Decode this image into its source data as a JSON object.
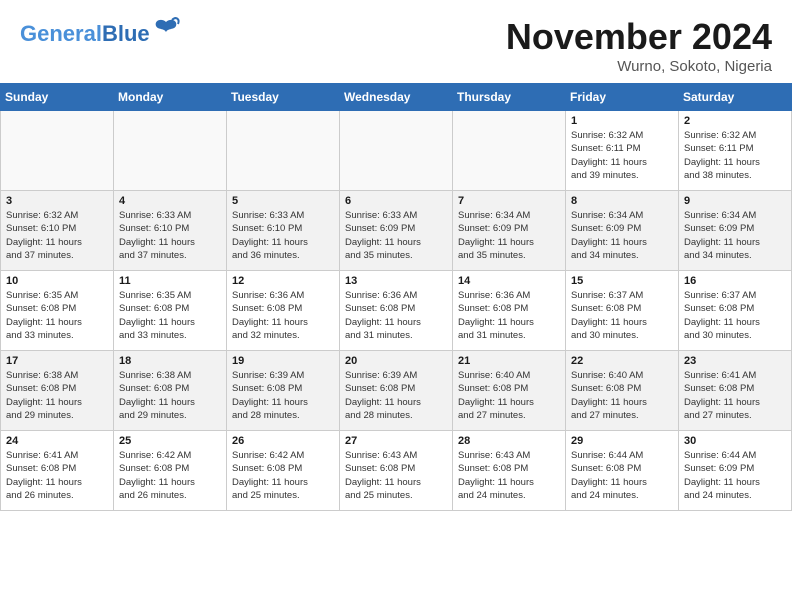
{
  "header": {
    "logo_general": "General",
    "logo_blue": "Blue",
    "title": "November 2024",
    "location": "Wurno, Sokoto, Nigeria"
  },
  "weekdays": [
    "Sunday",
    "Monday",
    "Tuesday",
    "Wednesday",
    "Thursday",
    "Friday",
    "Saturday"
  ],
  "weeks": [
    [
      {
        "day": "",
        "info": ""
      },
      {
        "day": "",
        "info": ""
      },
      {
        "day": "",
        "info": ""
      },
      {
        "day": "",
        "info": ""
      },
      {
        "day": "",
        "info": ""
      },
      {
        "day": "1",
        "info": "Sunrise: 6:32 AM\nSunset: 6:11 PM\nDaylight: 11 hours\nand 39 minutes."
      },
      {
        "day": "2",
        "info": "Sunrise: 6:32 AM\nSunset: 6:11 PM\nDaylight: 11 hours\nand 38 minutes."
      }
    ],
    [
      {
        "day": "3",
        "info": "Sunrise: 6:32 AM\nSunset: 6:10 PM\nDaylight: 11 hours\nand 37 minutes."
      },
      {
        "day": "4",
        "info": "Sunrise: 6:33 AM\nSunset: 6:10 PM\nDaylight: 11 hours\nand 37 minutes."
      },
      {
        "day": "5",
        "info": "Sunrise: 6:33 AM\nSunset: 6:10 PM\nDaylight: 11 hours\nand 36 minutes."
      },
      {
        "day": "6",
        "info": "Sunrise: 6:33 AM\nSunset: 6:09 PM\nDaylight: 11 hours\nand 35 minutes."
      },
      {
        "day": "7",
        "info": "Sunrise: 6:34 AM\nSunset: 6:09 PM\nDaylight: 11 hours\nand 35 minutes."
      },
      {
        "day": "8",
        "info": "Sunrise: 6:34 AM\nSunset: 6:09 PM\nDaylight: 11 hours\nand 34 minutes."
      },
      {
        "day": "9",
        "info": "Sunrise: 6:34 AM\nSunset: 6:09 PM\nDaylight: 11 hours\nand 34 minutes."
      }
    ],
    [
      {
        "day": "10",
        "info": "Sunrise: 6:35 AM\nSunset: 6:08 PM\nDaylight: 11 hours\nand 33 minutes."
      },
      {
        "day": "11",
        "info": "Sunrise: 6:35 AM\nSunset: 6:08 PM\nDaylight: 11 hours\nand 33 minutes."
      },
      {
        "day": "12",
        "info": "Sunrise: 6:36 AM\nSunset: 6:08 PM\nDaylight: 11 hours\nand 32 minutes."
      },
      {
        "day": "13",
        "info": "Sunrise: 6:36 AM\nSunset: 6:08 PM\nDaylight: 11 hours\nand 31 minutes."
      },
      {
        "day": "14",
        "info": "Sunrise: 6:36 AM\nSunset: 6:08 PM\nDaylight: 11 hours\nand 31 minutes."
      },
      {
        "day": "15",
        "info": "Sunrise: 6:37 AM\nSunset: 6:08 PM\nDaylight: 11 hours\nand 30 minutes."
      },
      {
        "day": "16",
        "info": "Sunrise: 6:37 AM\nSunset: 6:08 PM\nDaylight: 11 hours\nand 30 minutes."
      }
    ],
    [
      {
        "day": "17",
        "info": "Sunrise: 6:38 AM\nSunset: 6:08 PM\nDaylight: 11 hours\nand 29 minutes."
      },
      {
        "day": "18",
        "info": "Sunrise: 6:38 AM\nSunset: 6:08 PM\nDaylight: 11 hours\nand 29 minutes."
      },
      {
        "day": "19",
        "info": "Sunrise: 6:39 AM\nSunset: 6:08 PM\nDaylight: 11 hours\nand 28 minutes."
      },
      {
        "day": "20",
        "info": "Sunrise: 6:39 AM\nSunset: 6:08 PM\nDaylight: 11 hours\nand 28 minutes."
      },
      {
        "day": "21",
        "info": "Sunrise: 6:40 AM\nSunset: 6:08 PM\nDaylight: 11 hours\nand 27 minutes."
      },
      {
        "day": "22",
        "info": "Sunrise: 6:40 AM\nSunset: 6:08 PM\nDaylight: 11 hours\nand 27 minutes."
      },
      {
        "day": "23",
        "info": "Sunrise: 6:41 AM\nSunset: 6:08 PM\nDaylight: 11 hours\nand 27 minutes."
      }
    ],
    [
      {
        "day": "24",
        "info": "Sunrise: 6:41 AM\nSunset: 6:08 PM\nDaylight: 11 hours\nand 26 minutes."
      },
      {
        "day": "25",
        "info": "Sunrise: 6:42 AM\nSunset: 6:08 PM\nDaylight: 11 hours\nand 26 minutes."
      },
      {
        "day": "26",
        "info": "Sunrise: 6:42 AM\nSunset: 6:08 PM\nDaylight: 11 hours\nand 25 minutes."
      },
      {
        "day": "27",
        "info": "Sunrise: 6:43 AM\nSunset: 6:08 PM\nDaylight: 11 hours\nand 25 minutes."
      },
      {
        "day": "28",
        "info": "Sunrise: 6:43 AM\nSunset: 6:08 PM\nDaylight: 11 hours\nand 24 minutes."
      },
      {
        "day": "29",
        "info": "Sunrise: 6:44 AM\nSunset: 6:08 PM\nDaylight: 11 hours\nand 24 minutes."
      },
      {
        "day": "30",
        "info": "Sunrise: 6:44 AM\nSunset: 6:09 PM\nDaylight: 11 hours\nand 24 minutes."
      }
    ]
  ]
}
